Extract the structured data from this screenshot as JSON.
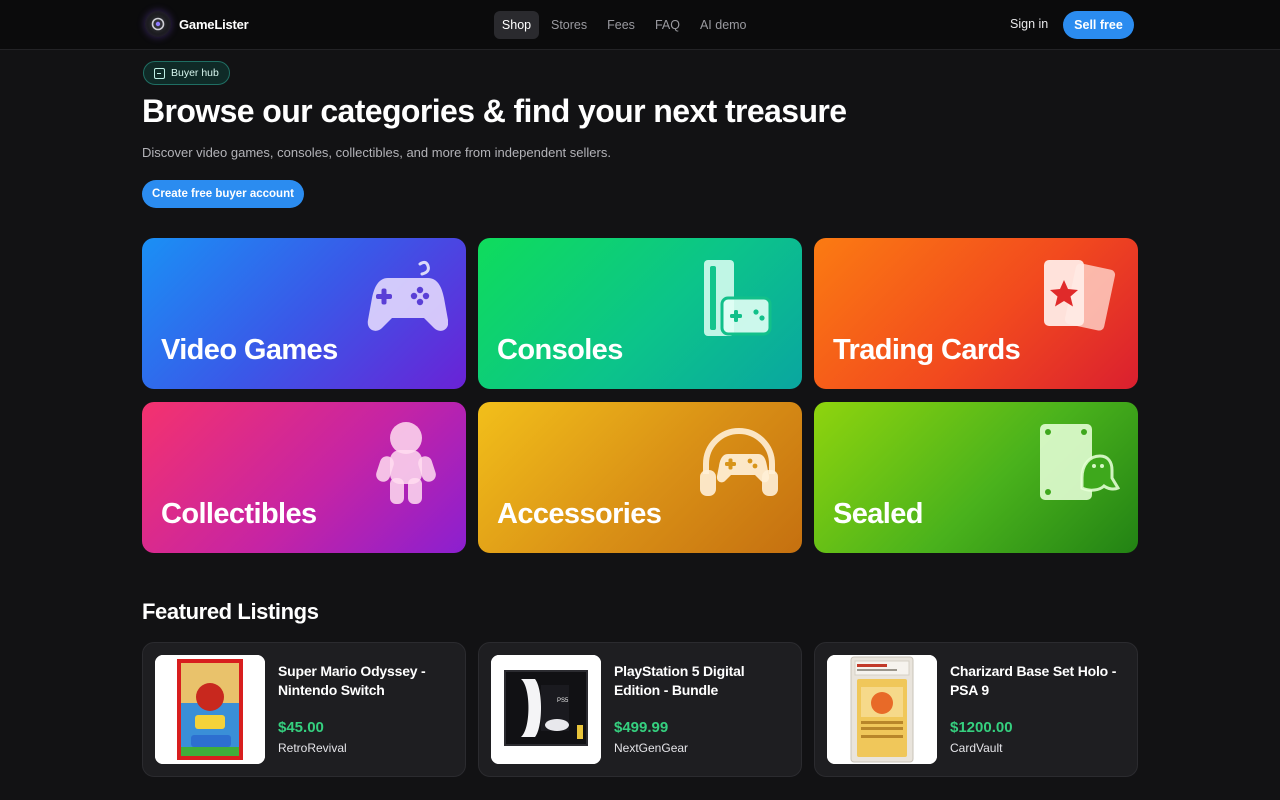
{
  "brand": {
    "name": "GameLister"
  },
  "nav": {
    "items": [
      {
        "label": "Shop",
        "active": true
      },
      {
        "label": "Stores"
      },
      {
        "label": "Fees"
      },
      {
        "label": "FAQ"
      },
      {
        "label": "AI demo"
      }
    ],
    "signin_label": "Sign in",
    "sell_label": "Sell free"
  },
  "hero": {
    "badge_label": "Buyer hub",
    "title": "Browse our categories & find your next treasure",
    "subtitle": "Discover video games, consoles, collectibles, and more from independent sellers.",
    "cta_label": "Create free buyer account"
  },
  "categories": [
    {
      "label": "Video Games",
      "icon": "gamepad-icon"
    },
    {
      "label": "Consoles",
      "icon": "console-icon"
    },
    {
      "label": "Trading Cards",
      "icon": "cards-icon"
    },
    {
      "label": "Collectibles",
      "icon": "figure-icon"
    },
    {
      "label": "Accessories",
      "icon": "headset-icon"
    },
    {
      "label": "Sealed",
      "icon": "sealed-box-icon"
    }
  ],
  "featured": {
    "title": "Featured Listings",
    "listings": [
      {
        "title": "Super Mario Odyssey - Nintendo Switch",
        "price": "$45.00",
        "seller": "RetroRevival"
      },
      {
        "title": "PlayStation 5 Digital Edition - Bundle",
        "price": "$499.99",
        "seller": "NextGenGear"
      },
      {
        "title": "Charizard Base Set Holo - PSA 9",
        "price": "$1200.00",
        "seller": "CardVault"
      }
    ]
  },
  "colors": {
    "accent": "#2b8cf0",
    "price": "#35d07f",
    "background": "#121214"
  }
}
